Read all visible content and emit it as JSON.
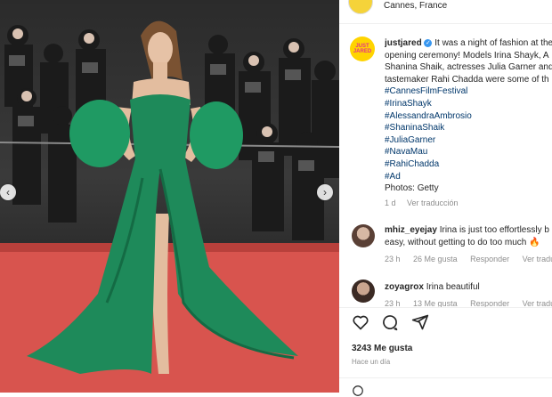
{
  "post": {
    "location": "Cannes, France",
    "account": "justjared",
    "avatar_text": "JUST JARED",
    "caption_lines": [
      "It was a night of fashion at the",
      "opening ceremony! Models Irina Shayk, A",
      "Shanina Shaik, actresses Julia Garner and",
      "tastemaker Rahi Chadda were some of th"
    ],
    "hashtags": [
      "#CannesFilmFestival",
      "#IrinaShayk",
      "#AlessandraAmbrosio",
      "#ShaninaShaik",
      "#JuliaGarner",
      "#NavaMau",
      "#RahiChadda",
      "#Ad"
    ],
    "photo_credit": "Photos: Getty",
    "caption_time": "1 d",
    "caption_translate": "Ver traducción"
  },
  "comments": [
    {
      "user": "mhiz_eyejay",
      "text_line1": "Irina is just too effortlessly b",
      "text_line2": "easy, without getting to do too much 🔥",
      "time": "23 h",
      "likes": "26 Me gusta",
      "reply": "Responder",
      "translate": "Ver traducció"
    },
    {
      "user": "zoyagrox",
      "text_line1": "Irina beautiful",
      "time": "23 h",
      "likes": "13 Me gusta",
      "reply": "Responder",
      "translate": "Ver traducció"
    }
  ],
  "footer": {
    "likes": "3243 Me gusta",
    "ago": "Hace un día"
  },
  "icons": {
    "like": "heart-icon",
    "comment": "comment-icon",
    "share": "share-icon",
    "prev": "chevron-left-icon",
    "next": "chevron-right-icon",
    "verified": "verified-badge-icon"
  },
  "colors": {
    "dress": "#1e8a5a",
    "carpet": "#d8544e",
    "link": "#00376b",
    "verified": "#3897f0",
    "avatar_bg": "#ffd400"
  }
}
